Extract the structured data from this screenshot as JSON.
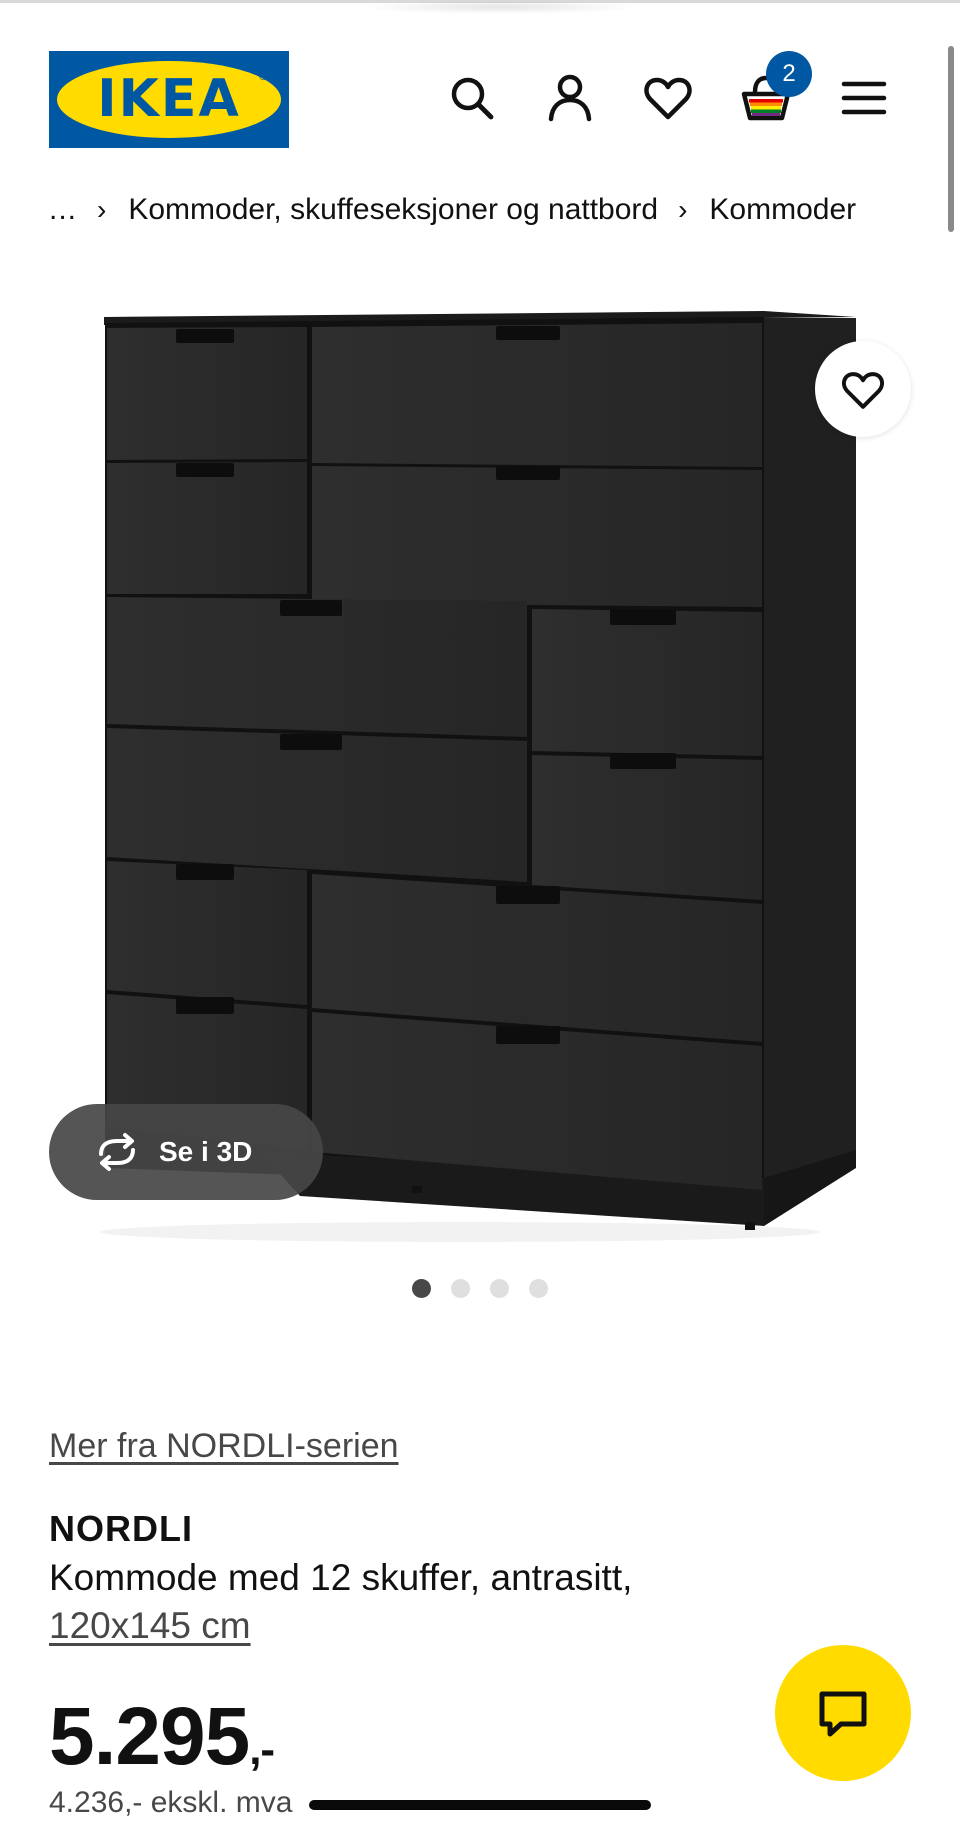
{
  "header": {
    "logo_text": "IKEA",
    "logo_mark": "®",
    "icons": [
      "search-icon",
      "account-icon",
      "heart-icon",
      "cart-icon",
      "menu-icon"
    ],
    "cart_count": "2"
  },
  "breadcrumb": {
    "ellipsis": "...",
    "separator": "›",
    "items": [
      "Kommoder, skuffeseksjoner og nattbord",
      "Kommoder"
    ]
  },
  "gallery": {
    "view_3d_label": "Se i 3D",
    "total_images": 4,
    "active_index": 0
  },
  "product": {
    "series_link": "Mer fra NORDLI-serien",
    "name": "NORDLI",
    "description": "Kommode med 12 skuffer, antrasitt,",
    "size": "120x145 cm",
    "price": "5.295",
    "price_suffix": ",-",
    "price_ex_vat": "4.236,- ekskl. mva"
  },
  "colors": {
    "ikea_blue": "#0058a3",
    "ikea_yellow": "#ffdb00",
    "dresser": "#2a2a2a",
    "text_secondary": "#484848"
  }
}
